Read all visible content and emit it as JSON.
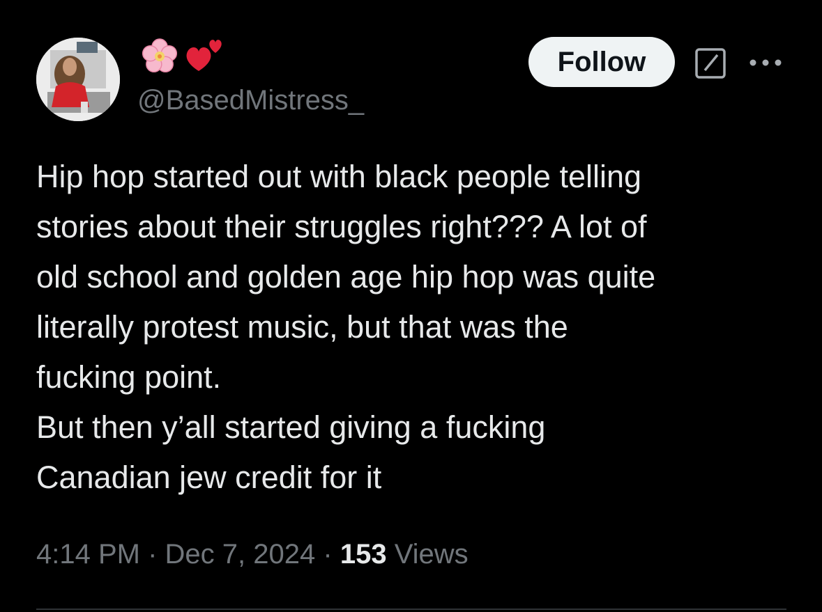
{
  "author": {
    "display_name_icons": [
      "cherry-blossom-icon",
      "two-hearts-icon"
    ],
    "handle": "@BasedMistress_"
  },
  "actions": {
    "follow_label": "Follow",
    "grok_icon": "grok-icon",
    "more_icon": "more-icon"
  },
  "tweet": {
    "lines": [
      "Hip hop started out with black people telling",
      "stories about their struggles right??? A lot of",
      "old school and golden age hip hop was quite",
      "literally protest music, but that was the",
      "fucking point.",
      "But then y’all started giving a fucking",
      "Canadian jew credit for it"
    ]
  },
  "meta": {
    "time": "4:14 PM",
    "separator": "·",
    "date": "Dec 7, 2024",
    "views_count": "153",
    "views_label": "Views"
  },
  "colors": {
    "background": "#000000",
    "text": "#e7e9ea",
    "secondary": "#71767b",
    "follow_bg": "#eff3f4",
    "divider": "#2f3336"
  }
}
